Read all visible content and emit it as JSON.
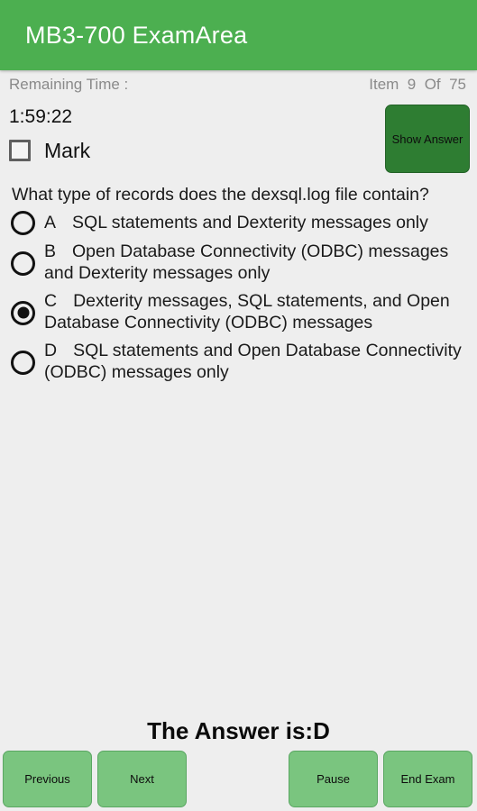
{
  "appbar": {
    "title": "MB3-700 ExamArea",
    "background_color": "#4caf50",
    "title_color": "#ffffff"
  },
  "status": {
    "remaining_time_label": "Remaining Time :",
    "item_progress": "Item  9  Of  75",
    "current_item": 9,
    "total_items": 75
  },
  "timer": {
    "value": "1:59:22"
  },
  "mark": {
    "label": "Mark",
    "checked": false
  },
  "show_answer": {
    "label": "Show Answer",
    "color": "#2e7d32"
  },
  "question": {
    "text": "What type of records does the dexsql.log file contain?"
  },
  "options": [
    {
      "letter": "A",
      "text": "SQL statements and Dexterity messages only",
      "selected": false
    },
    {
      "letter": "B",
      "text": "Open Database Connectivity (ODBC) messages and Dexterity messages only",
      "selected": false
    },
    {
      "letter": "C",
      "text": "Dexterity messages, SQL statements, and Open Database Connectivity (ODBC) messages",
      "selected": true
    },
    {
      "letter": "D",
      "text": "SQL statements and Open Database Connectivity (ODBC) messages only",
      "selected": false
    }
  ],
  "answer": {
    "text": "The Answer is:D",
    "correct_letter": "D"
  },
  "bottom_buttons": {
    "previous": "Previous",
    "next": "Next",
    "pause": "Pause",
    "end_exam": "End Exam",
    "color": "#7ac57f"
  }
}
